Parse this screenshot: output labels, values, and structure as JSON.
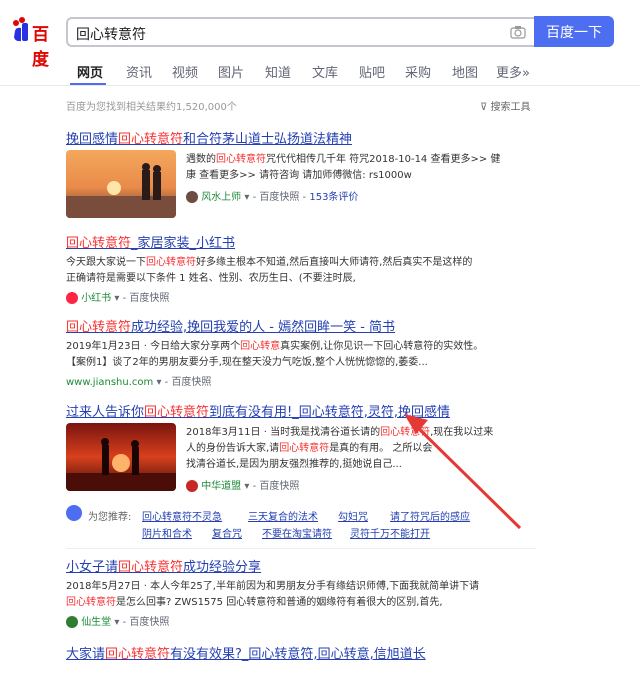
{
  "header": {
    "logo_text": "百度",
    "query": "回心转意符",
    "search_button": "百度一下"
  },
  "tabs": [
    "网页",
    "资讯",
    "视频",
    "图片",
    "知道",
    "文库",
    "贴吧",
    "采购",
    "地图",
    "更多»"
  ],
  "result_count": "百度为您找到相关结果约1,520,000个",
  "tools": "搜索工具",
  "results": [
    {
      "title_a": "挽回感情",
      "title_hl": "回心转意符",
      "title_b": "和合符茅山道士弘扬道法精神",
      "snippet": [
        {
          "a": "遇数的",
          "hl": "回心转意符",
          "b": "咒代代相传几千年 符咒2018-10-14 查看更多>> 健"
        },
        {
          "a": "康 查看更多>> 请符咨询 请加师傅微信: rs1000w",
          "hl": "",
          "b": ""
        }
      ],
      "source": "风水上师",
      "kuaizhao": "百度快照",
      "extra": "153条评价"
    },
    {
      "title_a": "",
      "title_hl": "回心转意符",
      "title_b": "_家居家装_小红书",
      "snippet": [
        {
          "a": "今天跟大家说一下",
          "hl": "回心转意符",
          "b": "好多缘主根本不知道,然后直接叫大师请符,然后真实不是这样的"
        },
        {
          "a": "正确请符是需要以下条件 1 姓名、性别、农历生日、(不要注时辰,",
          "hl": "",
          "b": ""
        }
      ],
      "source": "小红书",
      "kuaizhao": "百度快照"
    },
    {
      "title_a": "",
      "title_hl": "回心转意符",
      "title_b": "成功经验,挽回我爱的人 - 嫣然回眸一笑 - 简书",
      "snippet": [
        {
          "a": "2019年1月23日 · 今日给大家分享两个",
          "hl": "回心转意",
          "b": "真实案例,让你见识一下回心转意符的实效性。"
        },
        {
          "a": "【案例1】谈了2年的男朋友要分手,现在整天没力气吃饭,整个人恍恍惚惚的,萎委...",
          "hl": "",
          "b": ""
        }
      ],
      "source": "www.jianshu.com",
      "kuaizhao": "百度快照"
    },
    {
      "title_a": "过来人告诉你",
      "title_hl": "回心转意符",
      "title_b": "到底有没有用!_回心转意符,灵符,挽回感情",
      "snippet": [
        {
          "a": "2018年3月11日 · 当时我是找清谷道长请的",
          "hl": "回心转意符",
          "b": ",现在我以过来"
        },
        {
          "a": "人的身份告诉大家,请",
          "hl": "回心转意符",
          "b": "是真的有用。 之所以会"
        },
        {
          "a": "找清谷道长,是因为朋友强烈推荐的,挺她说自己...",
          "hl": "",
          "b": ""
        }
      ],
      "source": "中华道盟",
      "kuaizhao": "百度快照"
    },
    {
      "title_a": "小女子请",
      "title_hl": "回心转意符",
      "title_b": "成功经验分享",
      "snippet": [
        {
          "a": "2018年5月27日 · 本人今年25了,半年前因为和男朋友分手有缘结识师傅,下面我就简单讲下请",
          "hl": "",
          "b": ""
        },
        {
          "a": "",
          "hl": "回心转意符",
          "b": "是怎么回事? ZWS1575 回心转意符和普通的姻缘符有着很大的区别,首先,"
        }
      ],
      "source": "仙生堂",
      "kuaizhao": "百度快照"
    },
    {
      "title_a": "大家请",
      "title_hl": "回心转意符",
      "title_b": "有没有效果?_回心转意符,回心转意,信旭道长"
    }
  ],
  "related": {
    "label": "为您推荐:",
    "links": [
      "回心转意符不灵急",
      "三天复合的法术",
      "勾妇咒",
      "请了符咒后的感应",
      "阴片和合术",
      "复合咒",
      "不要在淘宝请符",
      "灵符千万不能打开"
    ]
  },
  "colors": {
    "link": "#2440b3",
    "highlight": "#f73131",
    "accent": "#4e6ef2",
    "arrow": "#e53935"
  }
}
